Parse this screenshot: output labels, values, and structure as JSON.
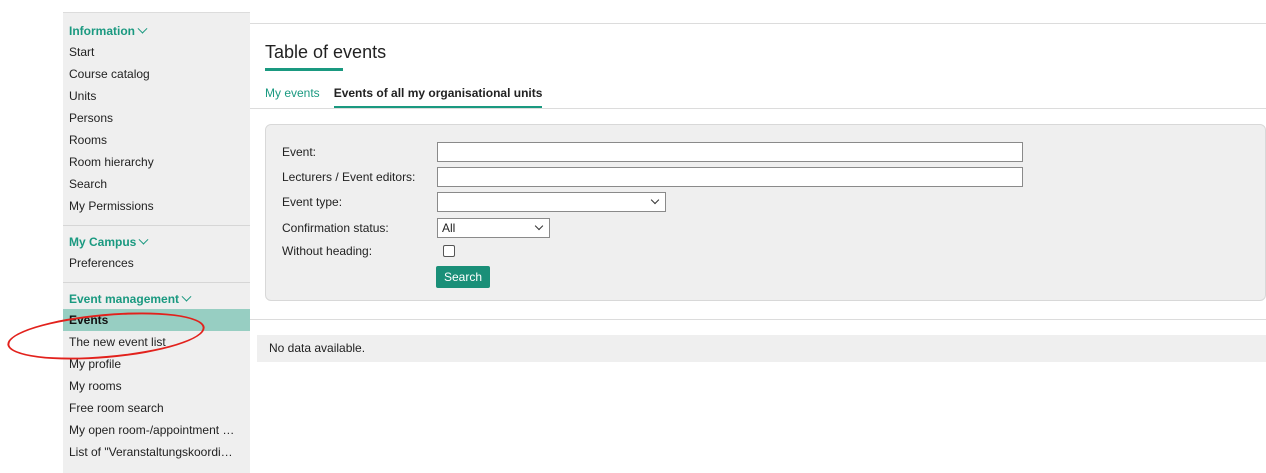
{
  "sidebar": {
    "sections": [
      {
        "title": "Information",
        "items": [
          "Start",
          "Course catalog",
          "Units",
          "Persons",
          "Rooms",
          "Room hierarchy",
          "Search",
          "My Permissions"
        ]
      },
      {
        "title": "My Campus",
        "items": [
          "Preferences"
        ]
      },
      {
        "title": "Event management",
        "items": [
          "Events",
          "The new event list",
          "My profile",
          "My rooms",
          "Free room search",
          "My open room-/appointment …",
          "List of \"Veranstaltungskoordi…"
        ]
      }
    ]
  },
  "main": {
    "title": "Table of events",
    "tabs": [
      {
        "label": "My events",
        "active": false
      },
      {
        "label": "Events of all my organisational units",
        "active": true
      }
    ],
    "form": {
      "event_label": "Event:",
      "event_value": "",
      "lecturers_label": "Lecturers / Event editors:",
      "lecturers_value": "",
      "event_type_label": "Event type:",
      "event_type_value": "",
      "confirmation_label": "Confirmation status:",
      "confirmation_value": "All",
      "without_heading_label": "Without heading:",
      "search_button": "Search"
    },
    "result_message": "No data available."
  },
  "colors": {
    "accent": "#1a9980",
    "active_item_bg": "#97cec2",
    "annotation_circle": "#e2211c"
  }
}
